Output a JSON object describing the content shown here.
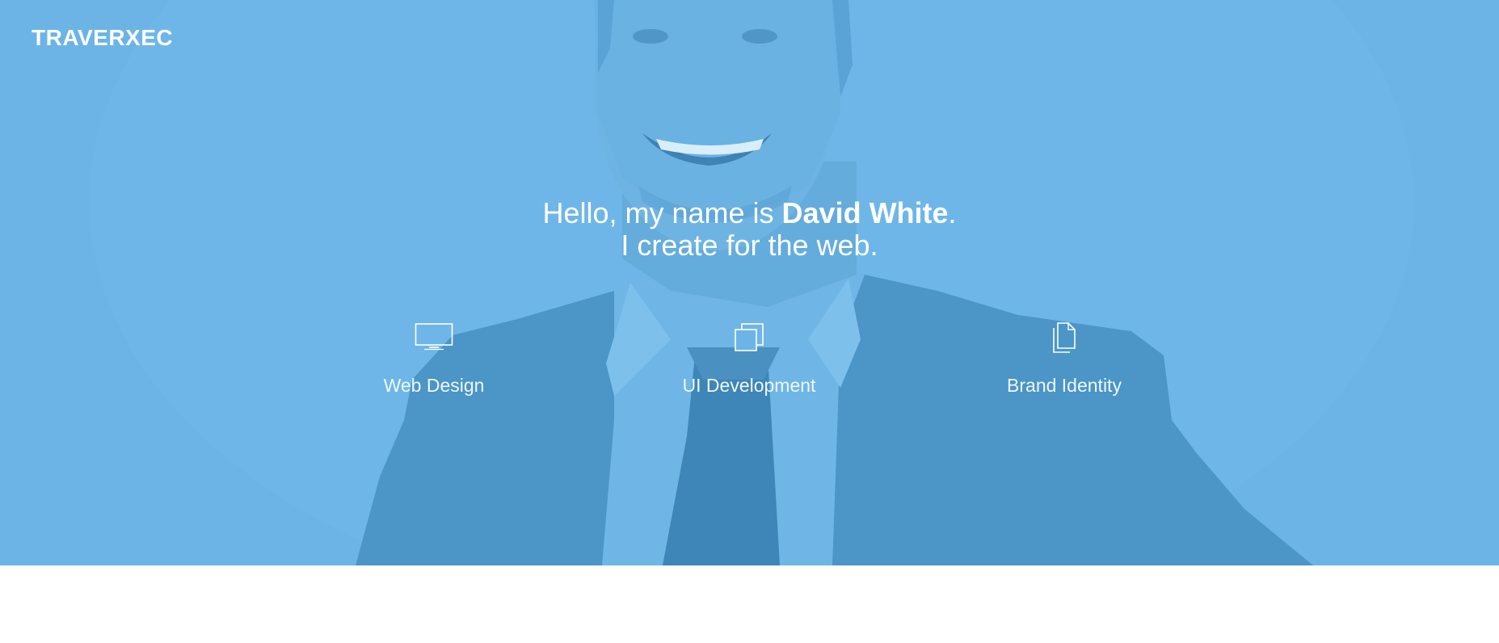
{
  "brand": {
    "logo_text": "TRAVERXEC"
  },
  "hero": {
    "greeting_prefix": "Hello, my name is ",
    "name": "David White",
    "greeting_suffix": ".",
    "tagline": "I create for the web.",
    "overlay_color": "#6cb4e6"
  },
  "services": [
    {
      "label": "Web Design",
      "icon": "monitor-icon"
    },
    {
      "label": "UI Development",
      "icon": "stacked-windows-icon"
    },
    {
      "label": "Brand Identity",
      "icon": "documents-icon"
    }
  ]
}
